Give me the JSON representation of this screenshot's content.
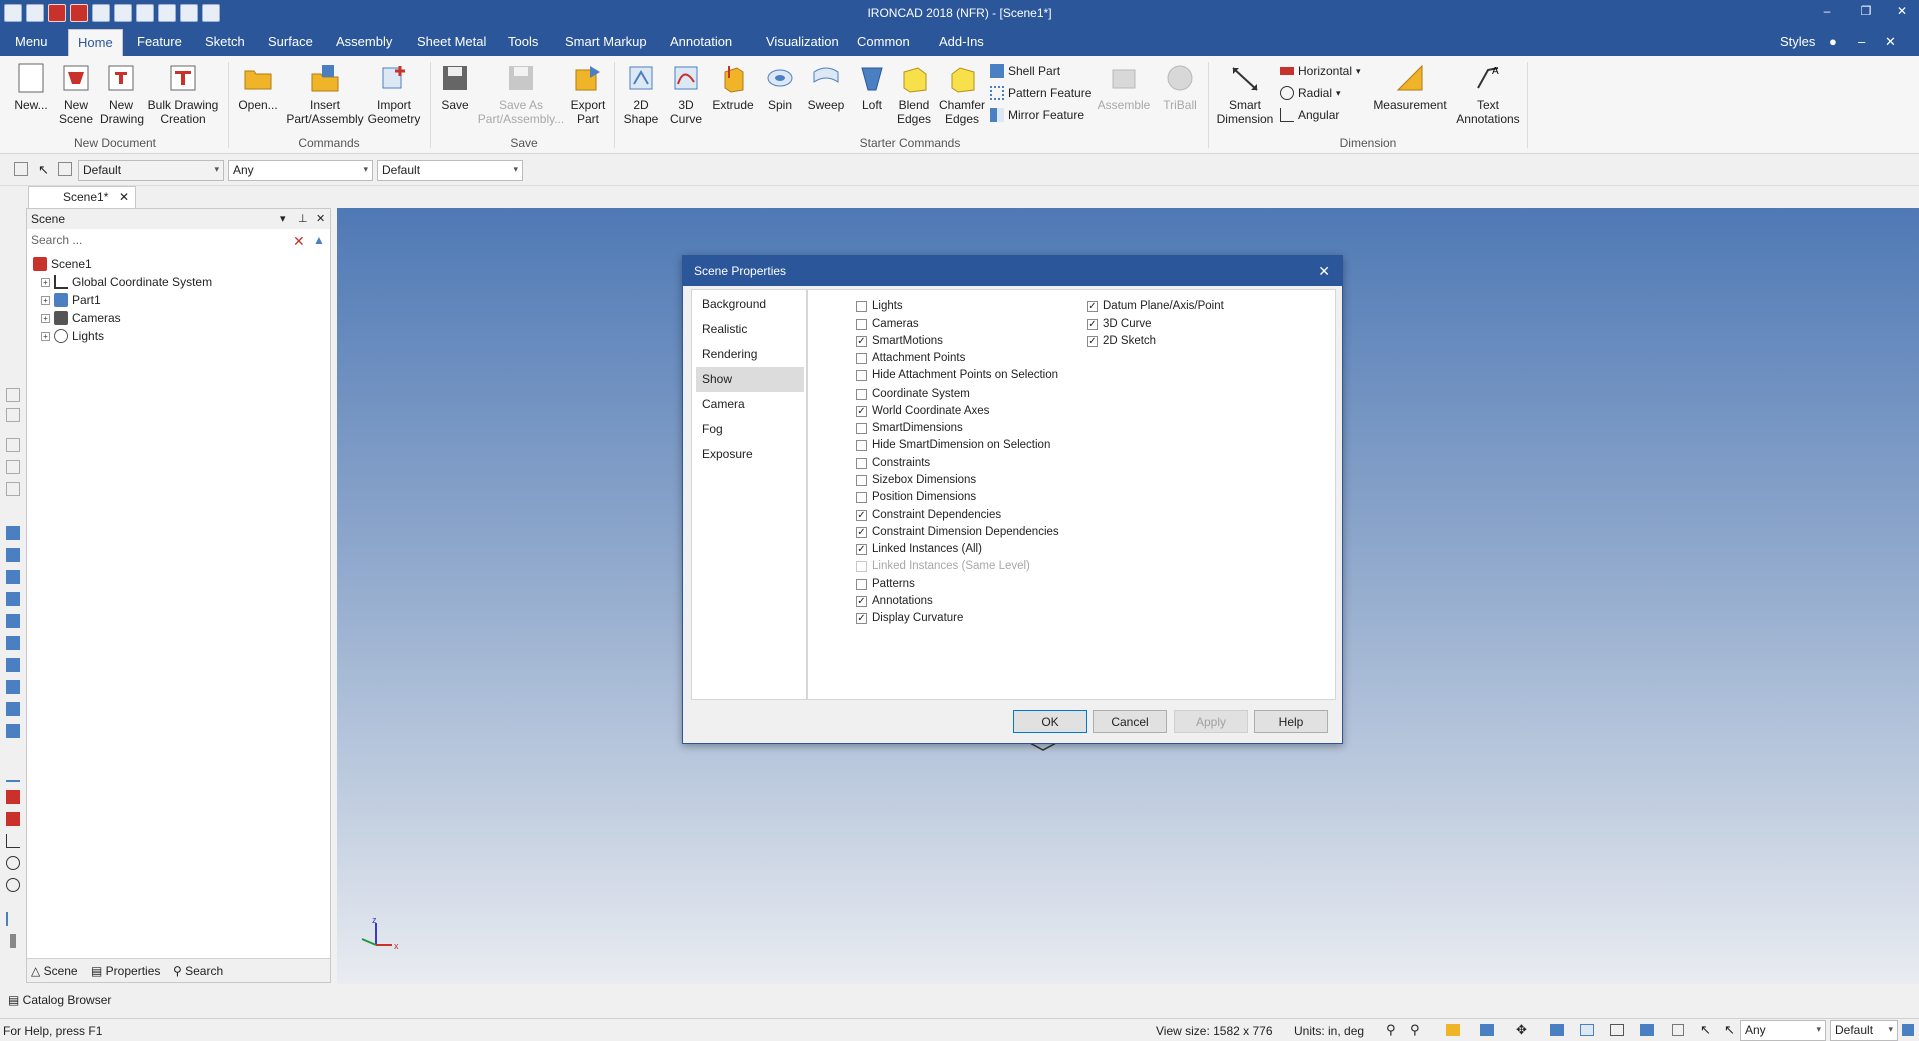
{
  "app": {
    "title": "IRONCAD 2018 (NFR) - [Scene1*]"
  },
  "ribbon_tabs": [
    "Menu",
    "Home",
    "Feature",
    "Sketch",
    "Surface",
    "Assembly",
    "Sheet Metal",
    "Tools",
    "Smart Markup",
    "Annotation",
    "Visualization",
    "Common",
    "Add-Ins"
  ],
  "ribbon_right": {
    "styles": "Styles"
  },
  "ribbon": {
    "new_document": {
      "label": "New Document",
      "new": "New...",
      "new_scene": "New Scene",
      "new_drawing": "New Drawing",
      "bulk_drawing": "Bulk Drawing Creation"
    },
    "commands": {
      "label": "Commands",
      "open": "Open...",
      "insert_part": "Insert Part/Assembly",
      "import_geometry": "Import Geometry"
    },
    "save": {
      "label": "Save",
      "save": "Save",
      "save_as": "Save As Part/Assembly...",
      "export_part": "Export Part"
    },
    "starter": {
      "label": "Starter Commands",
      "shape2d": "2D Shape",
      "curve3d": "3D Curve",
      "extrude": "Extrude",
      "spin": "Spin",
      "sweep": "Sweep",
      "loft": "Loft",
      "blend": "Blend Edges",
      "chamfer": "Chamfer Edges",
      "shell_part": "Shell Part",
      "pattern_feature": "Pattern Feature",
      "mirror_feature": "Mirror Feature",
      "assemble": "Assemble",
      "triball": "TriBall"
    },
    "dimension": {
      "label": "Dimension",
      "smart_dimension": "Smart Dimension",
      "horizontal": "Horizontal",
      "radial": "Radial",
      "angular": "Angular",
      "measurement": "Measurement",
      "text_annotations": "Text Annotations"
    }
  },
  "toolbar2": {
    "combo1": "Default",
    "combo2": "Any",
    "combo3": "Default"
  },
  "doc_tab": "Scene1*",
  "scene_panel": {
    "title": "Scene",
    "search_placeholder": "Search ...",
    "tree": [
      {
        "label": "Scene1"
      },
      {
        "label": "Global Coordinate System"
      },
      {
        "label": "Part1"
      },
      {
        "label": "Cameras"
      },
      {
        "label": "Lights"
      }
    ],
    "bottom_tabs": [
      "Scene",
      "Properties",
      "Search"
    ]
  },
  "catalog_browser": "Catalog Browser",
  "dialog": {
    "title": "Scene Properties",
    "nav": [
      "Background",
      "Realistic",
      "Rendering",
      "Show",
      "Camera",
      "Fog",
      "Exposure"
    ],
    "active_nav": "Show",
    "left_checks": [
      {
        "label": "Lights",
        "checked": false
      },
      {
        "label": "Cameras",
        "checked": false
      },
      {
        "label": "SmartMotions",
        "checked": true
      },
      {
        "label": "Attachment Points",
        "checked": false
      },
      {
        "label": "Hide Attachment Points on Selection",
        "checked": false
      },
      {
        "label": "Coordinate System",
        "checked": false
      },
      {
        "label": "World Coordinate Axes",
        "checked": true
      },
      {
        "label": "SmartDimensions",
        "checked": false
      },
      {
        "label": "Hide SmartDimension on Selection",
        "checked": false
      },
      {
        "label": "Constraints",
        "checked": false
      },
      {
        "label": "Sizebox Dimensions",
        "checked": false
      },
      {
        "label": "Position Dimensions",
        "checked": false
      },
      {
        "label": "Constraint Dependencies",
        "checked": true
      },
      {
        "label": "Constraint Dimension Dependencies",
        "checked": true
      },
      {
        "label": "Linked Instances (All)",
        "checked": true
      },
      {
        "label": "Linked Instances (Same Level)",
        "checked": false,
        "disabled": true
      },
      {
        "label": "Patterns",
        "checked": false
      },
      {
        "label": "Annotations",
        "checked": true
      },
      {
        "label": "Display Curvature",
        "checked": true
      }
    ],
    "right_checks": [
      {
        "label": "Datum Plane/Axis/Point",
        "checked": true
      },
      {
        "label": "3D Curve",
        "checked": true
      },
      {
        "label": "2D Sketch",
        "checked": true
      }
    ],
    "buttons": {
      "ok": "OK",
      "cancel": "Cancel",
      "apply": "Apply",
      "help": "Help"
    }
  },
  "status_bar": {
    "help": "For Help, press F1",
    "view_size": "View size: 1582 x 776",
    "units": "Units: in, deg",
    "combo1": "Any",
    "combo2": "Default"
  },
  "colors": {
    "title_bar": "#2b579a",
    "ribbon_bg": "#f6f6f6",
    "viewport_top": "#4f79b5",
    "viewport_bottom": "#e9ecf1"
  }
}
